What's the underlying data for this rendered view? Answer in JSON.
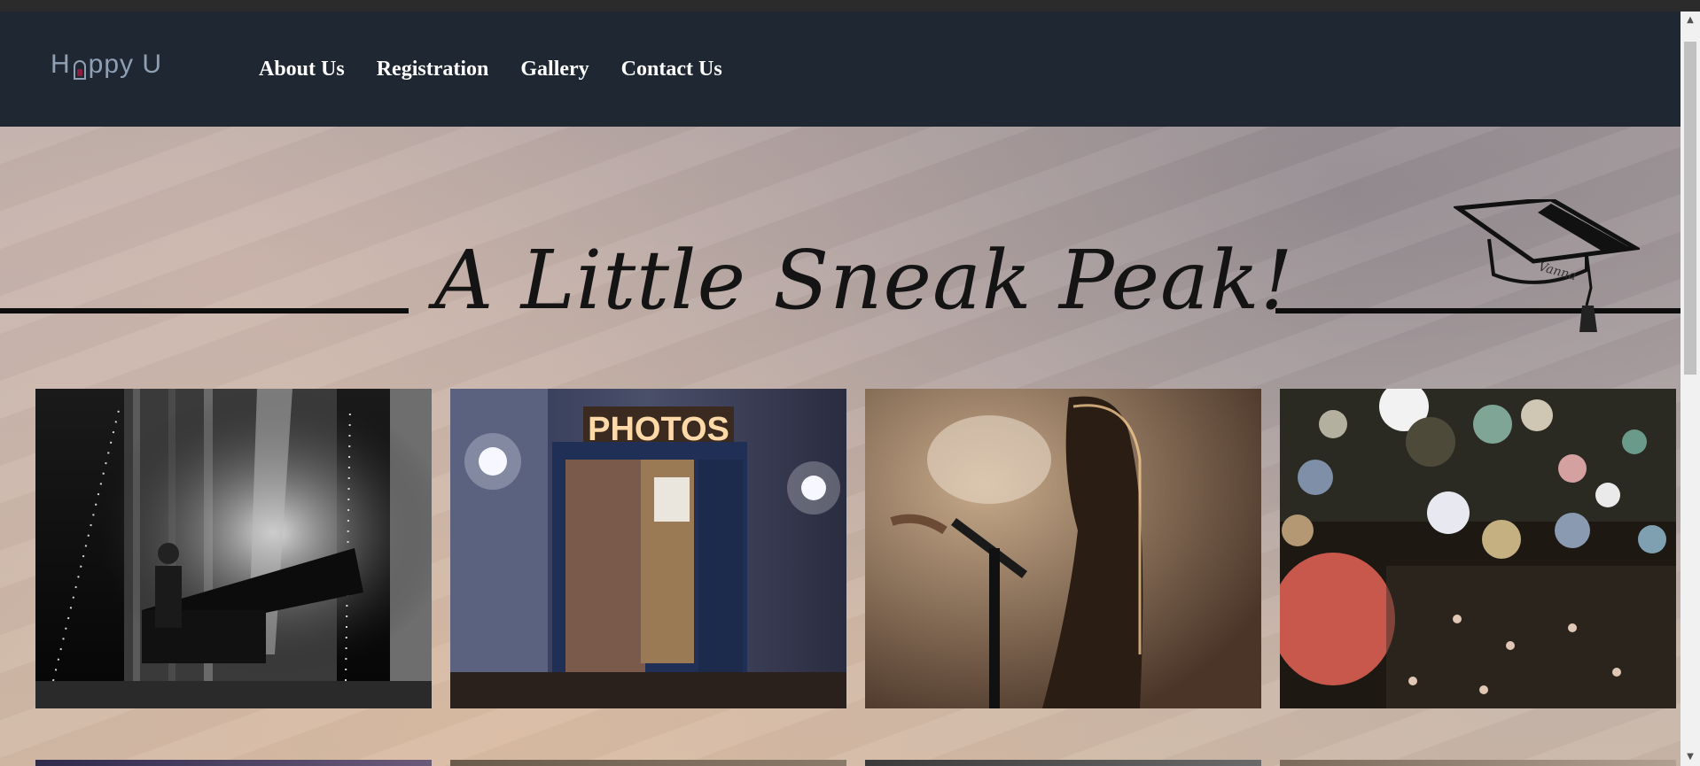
{
  "brand": {
    "logo_text_1": "H",
    "logo_text_2": "ppy U",
    "logo_color": "#8fa0b4",
    "logo_icon": "ghost-a-icon"
  },
  "nav": {
    "items": [
      {
        "label": "About Us"
      },
      {
        "label": "Registration"
      },
      {
        "label": "Gallery"
      },
      {
        "label": "Contact Us"
      }
    ],
    "background": "#1f2733"
  },
  "hero": {
    "title": "A Little Sneak Peak!",
    "decoration": "graduation-cap-icon",
    "cap_text": "Vanna"
  },
  "gallery": {
    "row1": [
      {
        "subject": "pianist-on-stage"
      },
      {
        "subject": "photo-booth",
        "sign": "PHOTOS"
      },
      {
        "subject": "singer-silhouette"
      },
      {
        "subject": "balloon-party-crowd"
      }
    ],
    "row2_count": 4
  }
}
